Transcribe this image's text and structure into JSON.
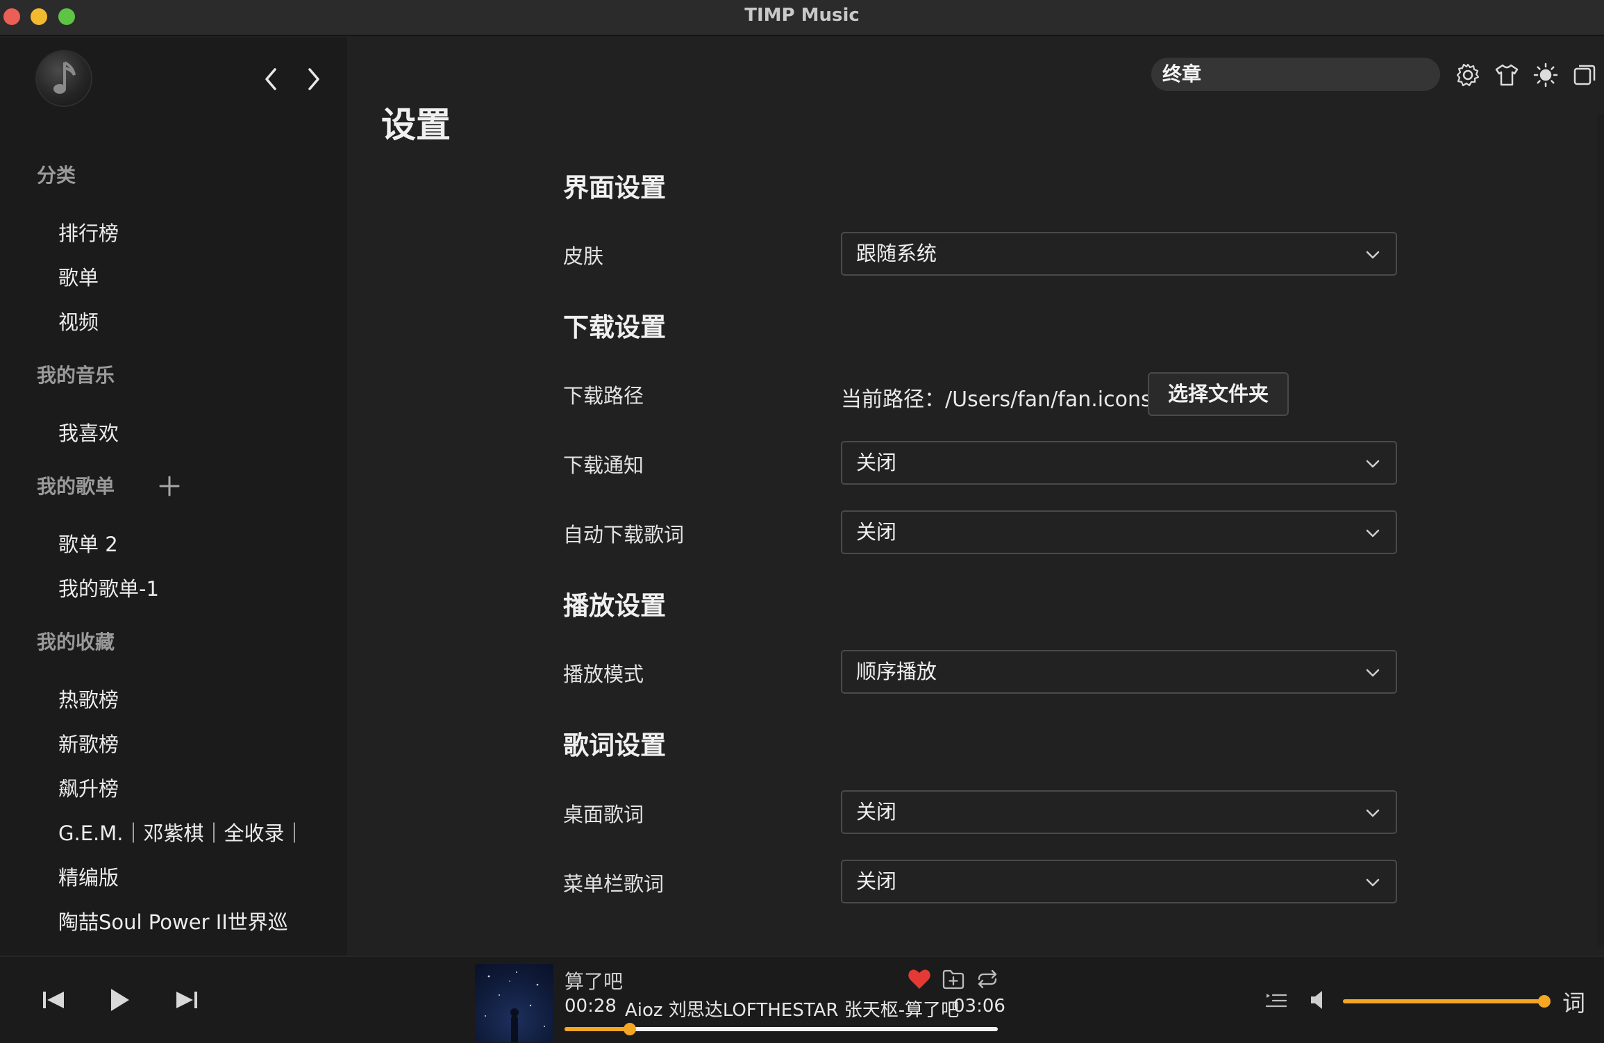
{
  "window": {
    "title": "TIMP Music"
  },
  "sidebar": {
    "sections": [
      {
        "title": "分类",
        "items": [
          "排行榜",
          "歌单",
          "视频"
        ]
      },
      {
        "title": "我的音乐",
        "items": [
          "我喜欢"
        ]
      },
      {
        "title": "我的歌单",
        "items": [
          "歌单 2",
          "我的歌单-1"
        ]
      },
      {
        "title": "我的收藏",
        "items": [
          "热歌榜",
          "新歌榜",
          "飙升榜",
          "G.E.M.｜邓紫棋｜全收录｜",
          "精编版",
          "陶喆Soul Power II世界巡"
        ]
      }
    ]
  },
  "header": {
    "search_value": "终章",
    "icons": [
      "settings-icon",
      "shirt-icon",
      "sun-icon",
      "window-icon"
    ]
  },
  "settings": {
    "page_title": "设置",
    "interface": {
      "title": "界面设置",
      "skin_label": "皮肤",
      "skin_value": "跟随系统"
    },
    "download": {
      "title": "下载设置",
      "path_label": "下载路径",
      "path_value": "当前路径：/Users/fan/fan.iconset",
      "choose_folder": "选择文件夹",
      "notify_label": "下载通知",
      "notify_value": "关闭",
      "auto_lyrics_label": "自动下载歌词",
      "auto_lyrics_value": "关闭"
    },
    "playback": {
      "title": "播放设置",
      "mode_label": "播放模式",
      "mode_value": "顺序播放"
    },
    "lyrics": {
      "title": "歌词设置",
      "desktop_label": "桌面歌词",
      "desktop_value": "关闭",
      "menubar_label": "菜单栏歌词",
      "menubar_value": "关闭"
    }
  },
  "player": {
    "track_title": "算了吧",
    "current_time": "00:28",
    "artist_line": "Aioz 刘思达LOFTHESTAR 张天枢-算了吧",
    "total_time": "03:06",
    "progress_fraction": 0.15,
    "volume_fraction": 1.0,
    "liked": true,
    "lyrics_button": "词",
    "accent_color": "#f5a623",
    "like_color": "#e53935"
  }
}
